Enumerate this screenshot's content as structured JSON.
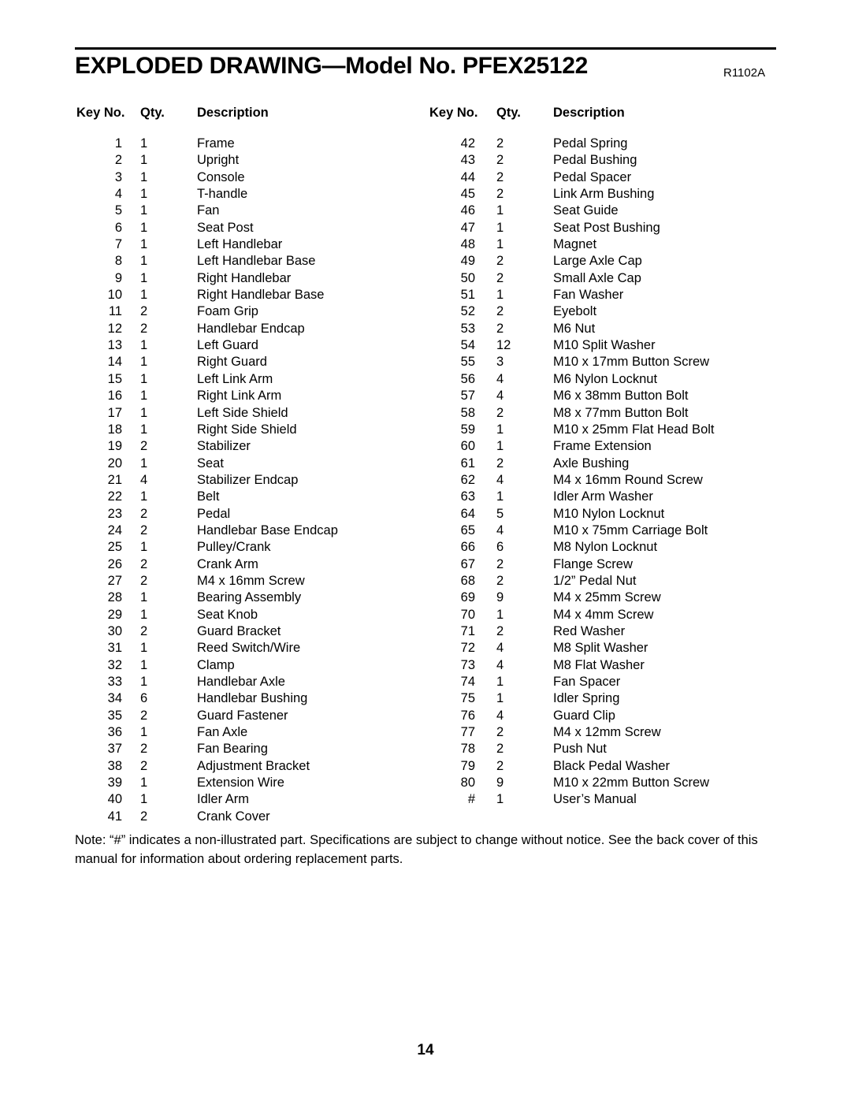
{
  "header": {
    "title": "EXPLODED DRAWING—Model No. PFEX25122",
    "revision": "R1102A"
  },
  "table": {
    "headers": {
      "key_no": "Key No.",
      "qty": "Qty.",
      "description": "Description"
    },
    "left_column": [
      {
        "key": "1",
        "qty": "1",
        "desc": "Frame"
      },
      {
        "key": "2",
        "qty": "1",
        "desc": "Upright"
      },
      {
        "key": "3",
        "qty": "1",
        "desc": "Console"
      },
      {
        "key": "4",
        "qty": "1",
        "desc": "T-handle"
      },
      {
        "key": "5",
        "qty": "1",
        "desc": "Fan"
      },
      {
        "key": "6",
        "qty": "1",
        "desc": "Seat Post"
      },
      {
        "key": "7",
        "qty": "1",
        "desc": "Left Handlebar"
      },
      {
        "key": "8",
        "qty": "1",
        "desc": "Left Handlebar Base"
      },
      {
        "key": "9",
        "qty": "1",
        "desc": "Right Handlebar"
      },
      {
        "key": "10",
        "qty": "1",
        "desc": "Right Handlebar Base"
      },
      {
        "key": "11",
        "qty": "2",
        "desc": "Foam Grip"
      },
      {
        "key": "12",
        "qty": "2",
        "desc": "Handlebar Endcap"
      },
      {
        "key": "13",
        "qty": "1",
        "desc": "Left Guard"
      },
      {
        "key": "14",
        "qty": "1",
        "desc": "Right Guard"
      },
      {
        "key": "15",
        "qty": "1",
        "desc": "Left Link Arm"
      },
      {
        "key": "16",
        "qty": "1",
        "desc": "Right Link Arm"
      },
      {
        "key": "17",
        "qty": "1",
        "desc": "Left Side Shield"
      },
      {
        "key": "18",
        "qty": "1",
        "desc": "Right Side Shield"
      },
      {
        "key": "19",
        "qty": "2",
        "desc": "Stabilizer"
      },
      {
        "key": "20",
        "qty": "1",
        "desc": "Seat"
      },
      {
        "key": "21",
        "qty": "4",
        "desc": "Stabilizer Endcap"
      },
      {
        "key": "22",
        "qty": "1",
        "desc": "Belt"
      },
      {
        "key": "23",
        "qty": "2",
        "desc": "Pedal"
      },
      {
        "key": "24",
        "qty": "2",
        "desc": "Handlebar Base Endcap"
      },
      {
        "key": "25",
        "qty": "1",
        "desc": "Pulley/Crank"
      },
      {
        "key": "26",
        "qty": "2",
        "desc": "Crank Arm"
      },
      {
        "key": "27",
        "qty": "2",
        "desc": "M4 x 16mm Screw"
      },
      {
        "key": "28",
        "qty": "1",
        "desc": "Bearing Assembly"
      },
      {
        "key": "29",
        "qty": "1",
        "desc": "Seat Knob"
      },
      {
        "key": "30",
        "qty": "2",
        "desc": "Guard Bracket"
      },
      {
        "key": "31",
        "qty": "1",
        "desc": "Reed Switch/Wire"
      },
      {
        "key": "32",
        "qty": "1",
        "desc": "Clamp"
      },
      {
        "key": "33",
        "qty": "1",
        "desc": "Handlebar Axle"
      },
      {
        "key": "34",
        "qty": "6",
        "desc": "Handlebar Bushing"
      },
      {
        "key": "35",
        "qty": "2",
        "desc": "Guard Fastener"
      },
      {
        "key": "36",
        "qty": "1",
        "desc": "Fan Axle"
      },
      {
        "key": "37",
        "qty": "2",
        "desc": "Fan Bearing"
      },
      {
        "key": "38",
        "qty": "2",
        "desc": "Adjustment Bracket"
      },
      {
        "key": "39",
        "qty": "1",
        "desc": "Extension Wire"
      },
      {
        "key": "40",
        "qty": "1",
        "desc": "Idler Arm"
      },
      {
        "key": "41",
        "qty": "2",
        "desc": "Crank Cover"
      }
    ],
    "right_column": [
      {
        "key": "42",
        "qty": "2",
        "desc": "Pedal Spring"
      },
      {
        "key": "43",
        "qty": "2",
        "desc": "Pedal Bushing"
      },
      {
        "key": "44",
        "qty": "2",
        "desc": "Pedal Spacer"
      },
      {
        "key": "45",
        "qty": "2",
        "desc": "Link Arm Bushing"
      },
      {
        "key": "46",
        "qty": "1",
        "desc": "Seat Guide"
      },
      {
        "key": "47",
        "qty": "1",
        "desc": "Seat Post Bushing"
      },
      {
        "key": "48",
        "qty": "1",
        "desc": "Magnet"
      },
      {
        "key": "49",
        "qty": "2",
        "desc": "Large Axle Cap"
      },
      {
        "key": "50",
        "qty": "2",
        "desc": "Small Axle Cap"
      },
      {
        "key": "51",
        "qty": "1",
        "desc": "Fan Washer"
      },
      {
        "key": "52",
        "qty": "2",
        "desc": "Eyebolt"
      },
      {
        "key": "53",
        "qty": "2",
        "desc": "M6 Nut"
      },
      {
        "key": "54",
        "qty": "12",
        "desc": "M10 Split Washer"
      },
      {
        "key": "55",
        "qty": "3",
        "desc": "M10 x 17mm Button Screw"
      },
      {
        "key": "56",
        "qty": "4",
        "desc": "M6 Nylon Locknut"
      },
      {
        "key": "57",
        "qty": "4",
        "desc": "M6 x 38mm Button Bolt"
      },
      {
        "key": "58",
        "qty": "2",
        "desc": "M8 x 77mm Button Bolt"
      },
      {
        "key": "59",
        "qty": "1",
        "desc": "M10 x 25mm Flat Head Bolt"
      },
      {
        "key": "60",
        "qty": "1",
        "desc": "Frame Extension"
      },
      {
        "key": "61",
        "qty": "2",
        "desc": "Axle Bushing"
      },
      {
        "key": "62",
        "qty": "4",
        "desc": "M4 x 16mm Round Screw"
      },
      {
        "key": "63",
        "qty": "1",
        "desc": "Idler Arm Washer"
      },
      {
        "key": "64",
        "qty": "5",
        "desc": "M10 Nylon Locknut"
      },
      {
        "key": "65",
        "qty": "4",
        "desc": "M10 x 75mm Carriage Bolt"
      },
      {
        "key": "66",
        "qty": "6",
        "desc": "M8 Nylon Locknut"
      },
      {
        "key": "67",
        "qty": "2",
        "desc": "Flange Screw"
      },
      {
        "key": "68",
        "qty": "2",
        "desc": "1/2” Pedal Nut"
      },
      {
        "key": "69",
        "qty": "9",
        "desc": "M4 x 25mm Screw"
      },
      {
        "key": "70",
        "qty": "1",
        "desc": "M4 x 4mm Screw"
      },
      {
        "key": "71",
        "qty": "2",
        "desc": "Red Washer"
      },
      {
        "key": "72",
        "qty": "4",
        "desc": "M8 Split Washer"
      },
      {
        "key": "73",
        "qty": "4",
        "desc": "M8 Flat Washer"
      },
      {
        "key": "74",
        "qty": "1",
        "desc": "Fan Spacer"
      },
      {
        "key": "75",
        "qty": "1",
        "desc": "Idler Spring"
      },
      {
        "key": "76",
        "qty": "4",
        "desc": "Guard Clip"
      },
      {
        "key": "77",
        "qty": "2",
        "desc": "M4 x 12mm Screw"
      },
      {
        "key": "78",
        "qty": "2",
        "desc": "Push Nut"
      },
      {
        "key": "79",
        "qty": "2",
        "desc": "Black Pedal Washer"
      },
      {
        "key": "80",
        "qty": "9",
        "desc": "M10 x 22mm Button Screw"
      },
      {
        "key": "#",
        "qty": "1",
        "desc": "User’s Manual"
      }
    ]
  },
  "note": "Note: “#” indicates a non-illustrated part. Specifications are subject to change without notice. See the back cover of this manual for information about ordering replacement parts.",
  "page_number": "14"
}
